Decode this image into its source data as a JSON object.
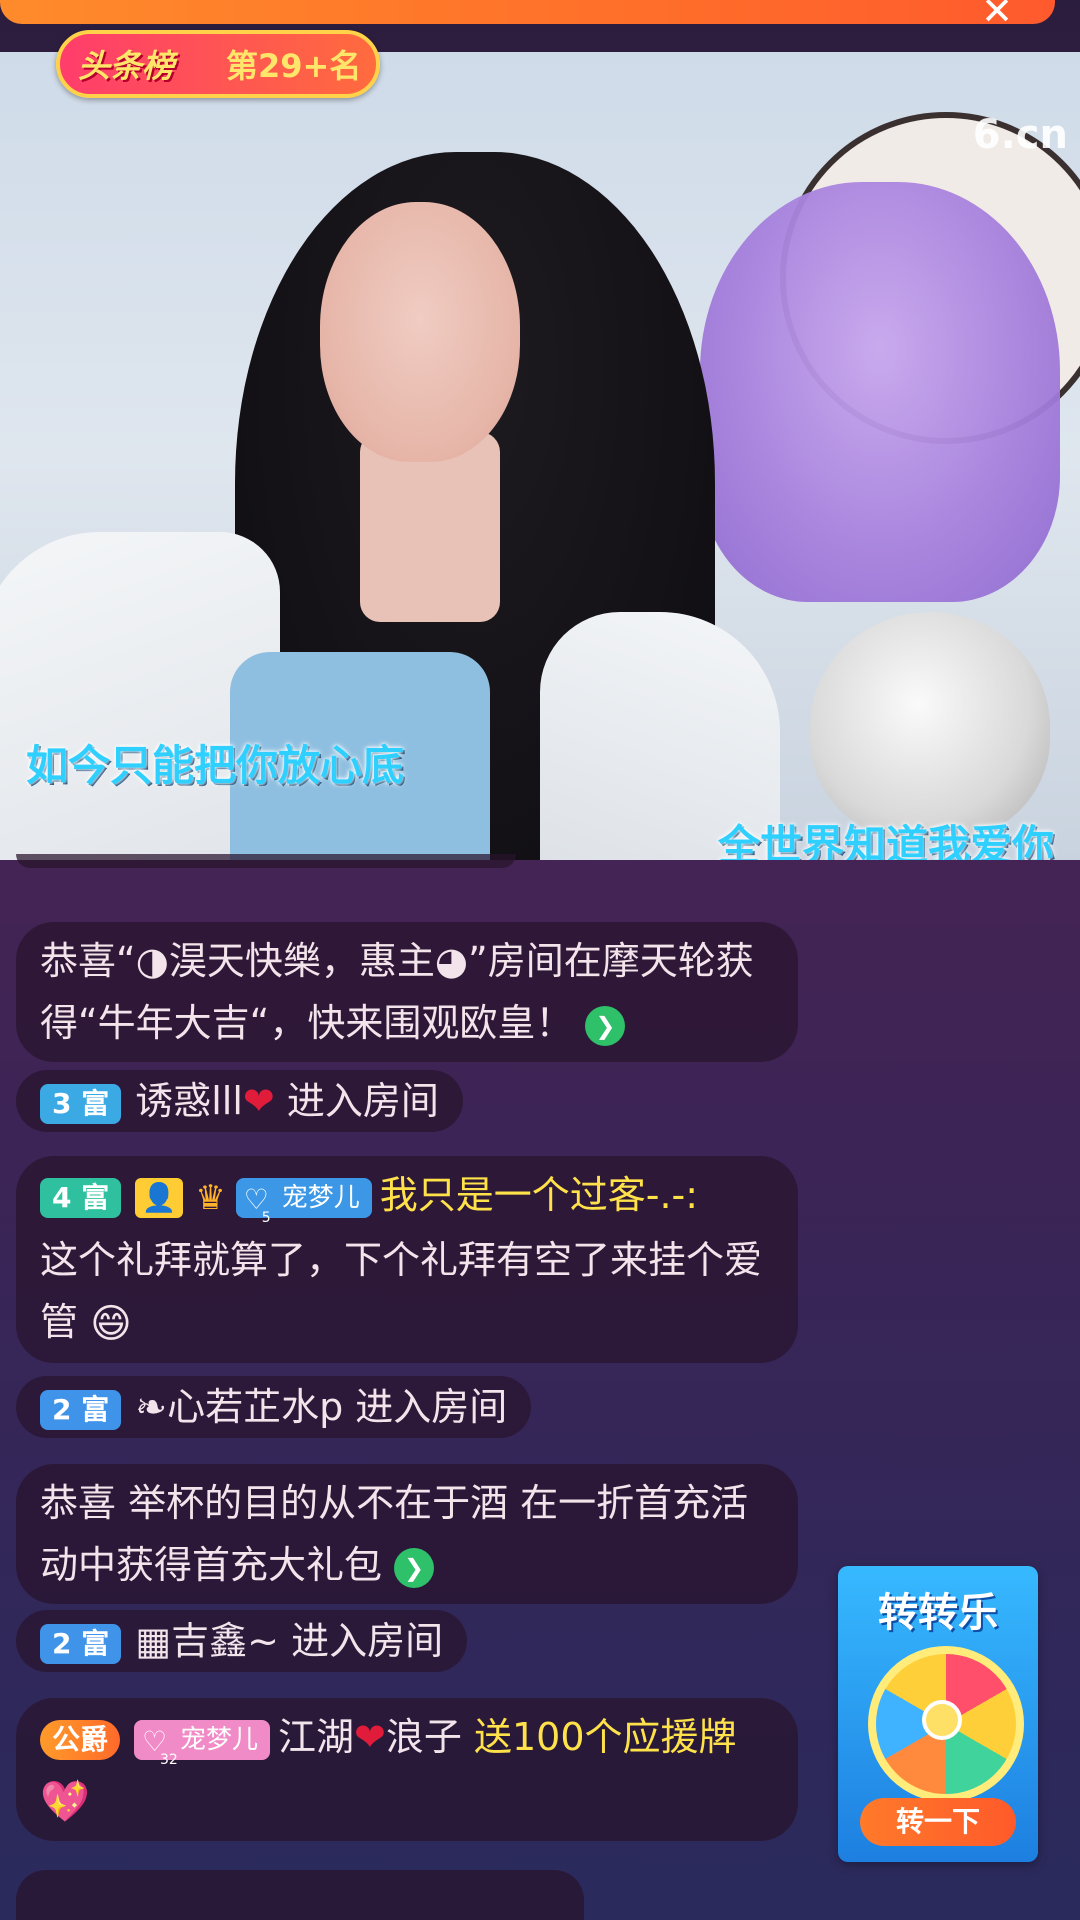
{
  "rank_badge": {
    "title": "头条榜",
    "value": "第29+名"
  },
  "video": {
    "watermark": "6.cn",
    "lyric_left": "如今只能把你放心底",
    "lyric_right": "全世界知道我爱你"
  },
  "chat": {
    "m1": {
      "prefix": "恭喜“",
      "name": "◑淏天快樂，惠主◕",
      "suffix": "”房间在摩天轮获得“牛年大吉“，快来围观欧皇！"
    },
    "m2": {
      "level": "3 富",
      "user": "诱惑lll",
      "action": "进入房间"
    },
    "m3": {
      "level": "4 富",
      "pet_label": "宠梦儿",
      "pet_level": "5",
      "user": "我只是一个过客-.-:",
      "text": "这个礼拜就算了，下个礼拜有空了来挂个爱管"
    },
    "m4": {
      "level": "2 富",
      "user": "❧心若芷水p",
      "action": "进入房间"
    },
    "m5": {
      "text": "恭喜 举杯的目的从不在于酒 在一折首充活动中获得首充大礼包"
    },
    "m6": {
      "level": "2 富",
      "user": "▦吉鑫~",
      "action": "进入房间"
    },
    "m7": {
      "rank": "公爵",
      "pet_label": "宠梦儿",
      "pet_level": "32",
      "user1": "江湖",
      "user2": "浪子",
      "gift": "送100个应援牌"
    }
  },
  "widget": {
    "title": "转转乐",
    "button": "转一下"
  },
  "colors": {
    "accent_orange": "#ff6f2a",
    "gold": "#ffe24a",
    "chat_bg": "rgba(40,20,45,.72)"
  }
}
